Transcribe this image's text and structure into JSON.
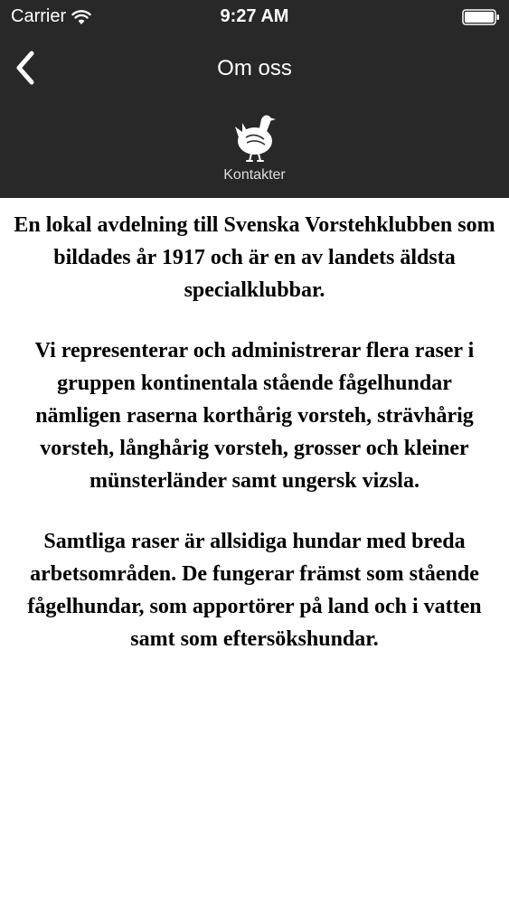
{
  "status_bar": {
    "carrier": "Carrier",
    "time": "9:27 AM"
  },
  "nav": {
    "title": "Om oss",
    "back_icon": "chevron-left-icon"
  },
  "contact_tab": {
    "label": "Kontakter",
    "icon": "bird-icon"
  },
  "content": {
    "paragraphs": [
      "En lokal avdelning till Svenska Vorstehklubben som bildades år 1917 och är en av landets äldsta specialklubbar.",
      "Vi representerar och administrerar flera raser i gruppen kontinentala stående fågelhundar nämligen raserna korthårig vorsteh, strävhårig vorsteh, långhårig vorsteh, grosser och kleiner münsterländer samt ungersk vizsla.",
      "Samtliga raser är allsidiga hundar med breda arbetsområden. De fungerar främst som stående fågelhundar, som apportörer på land och i vatten samt som eftersökshundar."
    ]
  },
  "colors": {
    "header_background": "#282828",
    "text": "#000000",
    "header_text": "#ffffff"
  }
}
